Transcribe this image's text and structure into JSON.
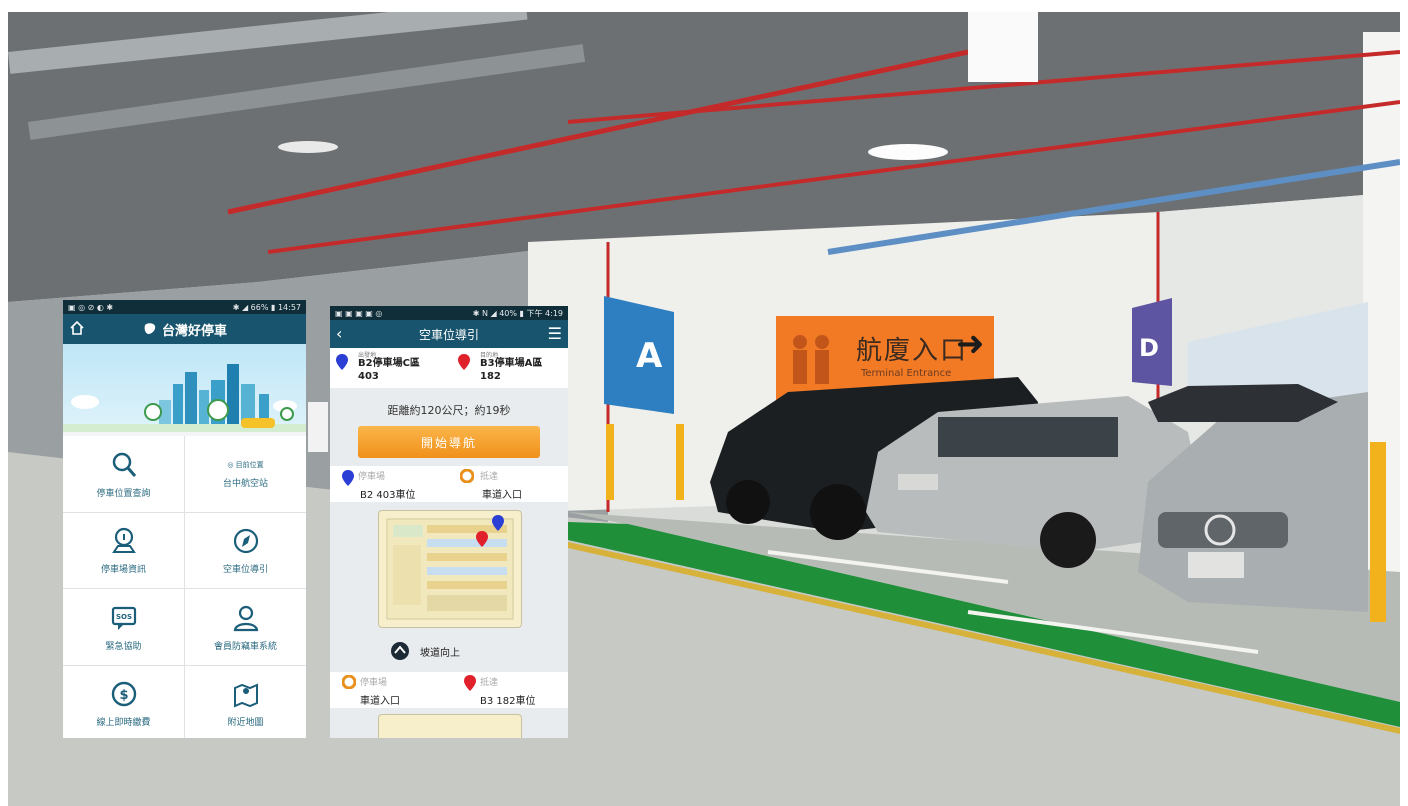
{
  "scene": {
    "signs": {
      "zone_a": "A",
      "zone_d": "D",
      "terminal_entrance": "航廈入口",
      "terminal_entrance_en": "Terminal Entrance",
      "arrow": "➜"
    },
    "colors": {
      "ceiling": "#6d7072",
      "wall": "#efefec",
      "floor": "#c7c9c5",
      "pipe_red": "#c52a2a",
      "sign_blue": "#2d7fc1",
      "sign_orange": "#f27a25",
      "lane_green": "#1f8f3a"
    }
  },
  "phone1": {
    "status_left": "▣ ◎ ⊘ ◐ ✱",
    "status_right": "✱ ◢ 66% ▮ 14:57",
    "app_title": "台灣好停車",
    "home_icon": "home-icon",
    "tiles": [
      {
        "label": "停車位置查詢",
        "icon": "search-icon"
      },
      {
        "sub": "◎ 目前位置",
        "label": "台中航空站",
        "icon": "location-icon"
      },
      {
        "label": "停車場資訊",
        "icon": "parking-info-icon"
      },
      {
        "label": "空車位導引",
        "icon": "compass-icon"
      },
      {
        "label": "緊急協助",
        "icon": "sos-icon"
      },
      {
        "label": "會員防竊車系統",
        "icon": "user-icon"
      },
      {
        "label": "線上即時繳費",
        "icon": "dollar-icon"
      },
      {
        "label": "附近地圖",
        "icon": "map-icon"
      }
    ]
  },
  "phone2": {
    "status_left": "▣ ▣ ▣ ▣ ◎",
    "status_right": "✱ N ◢ 40% ▮ 下午 4:19",
    "title": "空車位導引",
    "origin_label": "出發地",
    "origin_line1": "B2停車場C區",
    "origin_line2": "403",
    "dest_label": "目的地",
    "dest_line1": "B3停車場A區",
    "dest_line2": "182",
    "distance": "距離約120公尺；約19秒",
    "navigate_button": "開始導航",
    "step1_from_label": "停車場",
    "step1_from_value": "B2 403車位",
    "step1_to_label": "抵達",
    "step1_to_value": "車道入口",
    "ramp": "坡道向上",
    "step2_from_label": "停車場",
    "step2_from_value": "車道入口",
    "step2_to_label": "抵達",
    "step2_to_value": "B3 182車位"
  }
}
